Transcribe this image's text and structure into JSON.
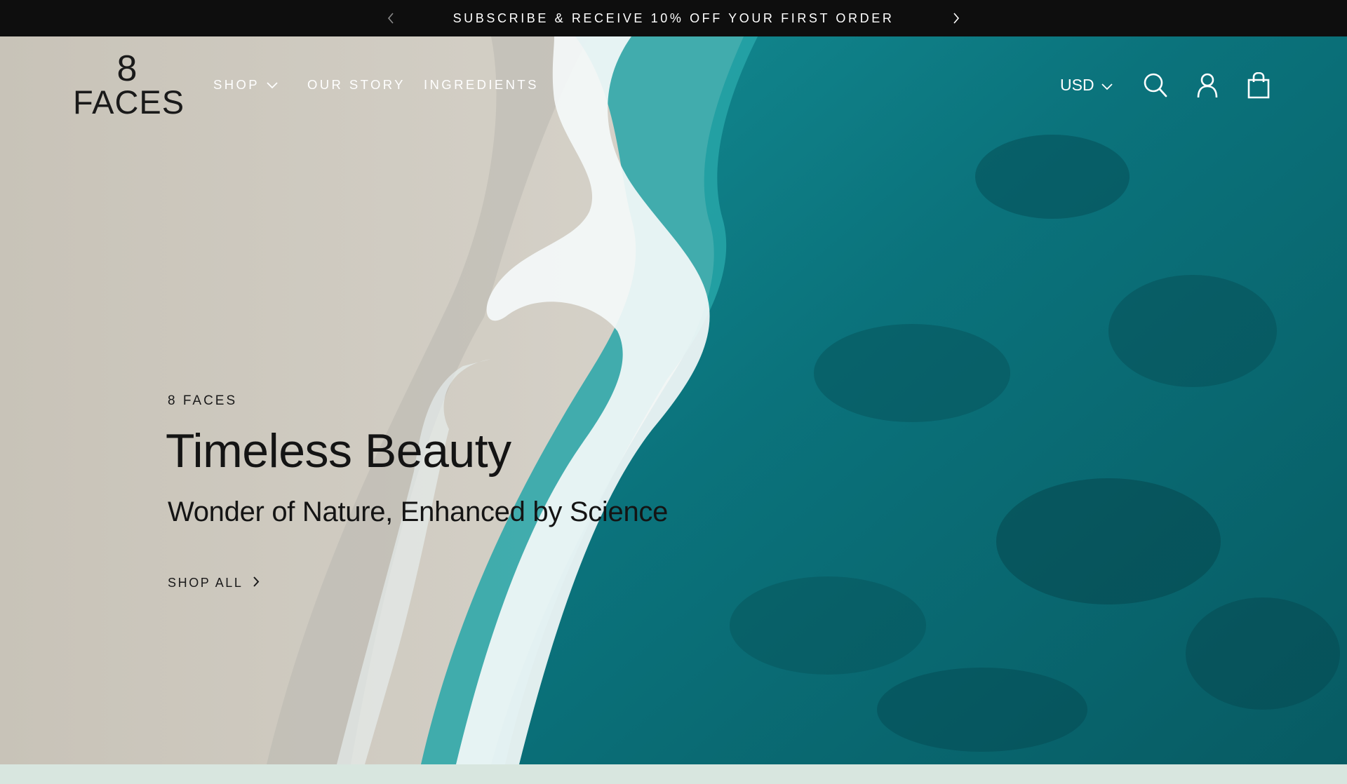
{
  "announcement": {
    "text": "SUBSCRIBE & RECEIVE 10% OFF YOUR FIRST ORDER",
    "prev_icon": "chevron-left-icon",
    "next_icon": "chevron-right-icon"
  },
  "header": {
    "logo": {
      "number": "8",
      "word": "FACES"
    },
    "nav": [
      {
        "label": "SHOP",
        "has_dropdown": true
      },
      {
        "label": "OUR STORY"
      },
      {
        "label": "INGREDIENTS"
      }
    ],
    "currency": "USD",
    "icons": [
      "search-icon",
      "account-icon",
      "cart-icon"
    ]
  },
  "hero": {
    "eyebrow": "8 FACES",
    "headline": "Timeless Beauty",
    "subheadline": "Wonder of Nature, Enhanced by Science",
    "cta_label": "SHOP ALL",
    "background": "aerial view of sandy beach meeting turquoise ocean waves"
  },
  "colors": {
    "announcement_bg": "#0e0e0e",
    "text_dark": "#141414",
    "nav_text": "#ffffff",
    "bottom_strip": "#d8e6df"
  }
}
